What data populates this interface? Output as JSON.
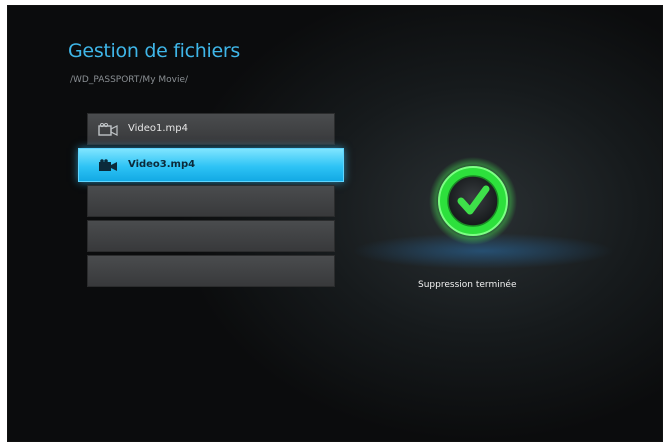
{
  "header": {
    "title": "Gestion de fichiers",
    "path": "/WD_PASSPORT/My Movie/"
  },
  "file_list": {
    "items": [
      {
        "name": "Video1.mp4",
        "icon": "video-camera-icon",
        "selected": false
      },
      {
        "name": "Video3.mp4",
        "icon": "video-camera-icon",
        "selected": true
      },
      {
        "name": "",
        "selected": false
      },
      {
        "name": "",
        "selected": false
      },
      {
        "name": "",
        "selected": false
      }
    ]
  },
  "status": {
    "icon": "success-check-icon",
    "message": "Suppression terminée"
  },
  "colors": {
    "accent": "#3fb6e8",
    "selection": "#2ec3f5",
    "success": "#3ee04a"
  }
}
